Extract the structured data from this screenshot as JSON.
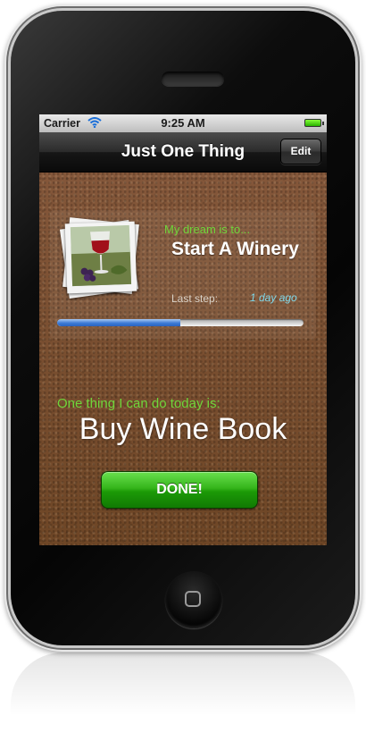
{
  "status_bar": {
    "carrier": "Carrier",
    "time": "9:25 AM"
  },
  "nav_bar": {
    "title": "Just One Thing",
    "edit_label": "Edit"
  },
  "dream": {
    "label": "My dream is to...",
    "title": "Start A Winery",
    "last_step_label": "Last step:",
    "last_step_value": "1 day ago",
    "progress_fraction": 0.5
  },
  "today": {
    "label": "One thing I can do today is:",
    "task": "Buy Wine Book"
  },
  "done_label": "DONE!",
  "colors": {
    "accent_green_text": "#6fd63a",
    "last_step_value": "#7fd8ea",
    "progress_blue": "#3d7bd6",
    "done_button_green": "#1c9a07"
  },
  "icons": [
    "wifi-icon",
    "battery-icon",
    "home-square-icon",
    "wine-glass-photo"
  ]
}
